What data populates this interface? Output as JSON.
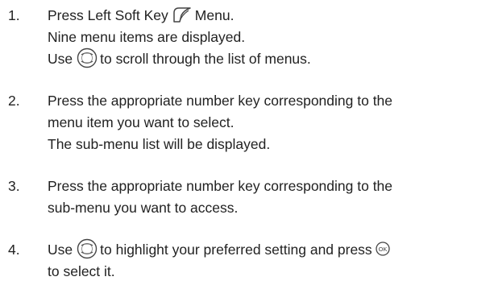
{
  "steps": [
    {
      "number": "1.",
      "line1_before_icon": "Press Left Soft Key",
      "line1_after_icon": "Menu.",
      "line2": "Nine menu items are displayed.",
      "line3_before_icon": "Use",
      "line3_after_icon": "to scroll through the list of menus."
    },
    {
      "number": "2.",
      "line1": "Press the appropriate number key corresponding to the",
      "line2": "menu item you want to select.",
      "line3": "The sub-menu list will be displayed."
    },
    {
      "number": "3.",
      "line1": "Press the appropriate number key corresponding to the",
      "line2": "sub-menu you want to access."
    },
    {
      "number": "4.",
      "line1_before_icon": "Use",
      "line1_mid": "to highlight your preferred setting and press",
      "line2": "to select it."
    }
  ],
  "icons": {
    "left_soft_key": "left-soft-key-icon",
    "navigation": "navigation-key-icon",
    "ok": "ok-key-icon",
    "ok_label": "OK"
  },
  "colors": {
    "text": "#222222",
    "icon_stroke": "#444444"
  }
}
